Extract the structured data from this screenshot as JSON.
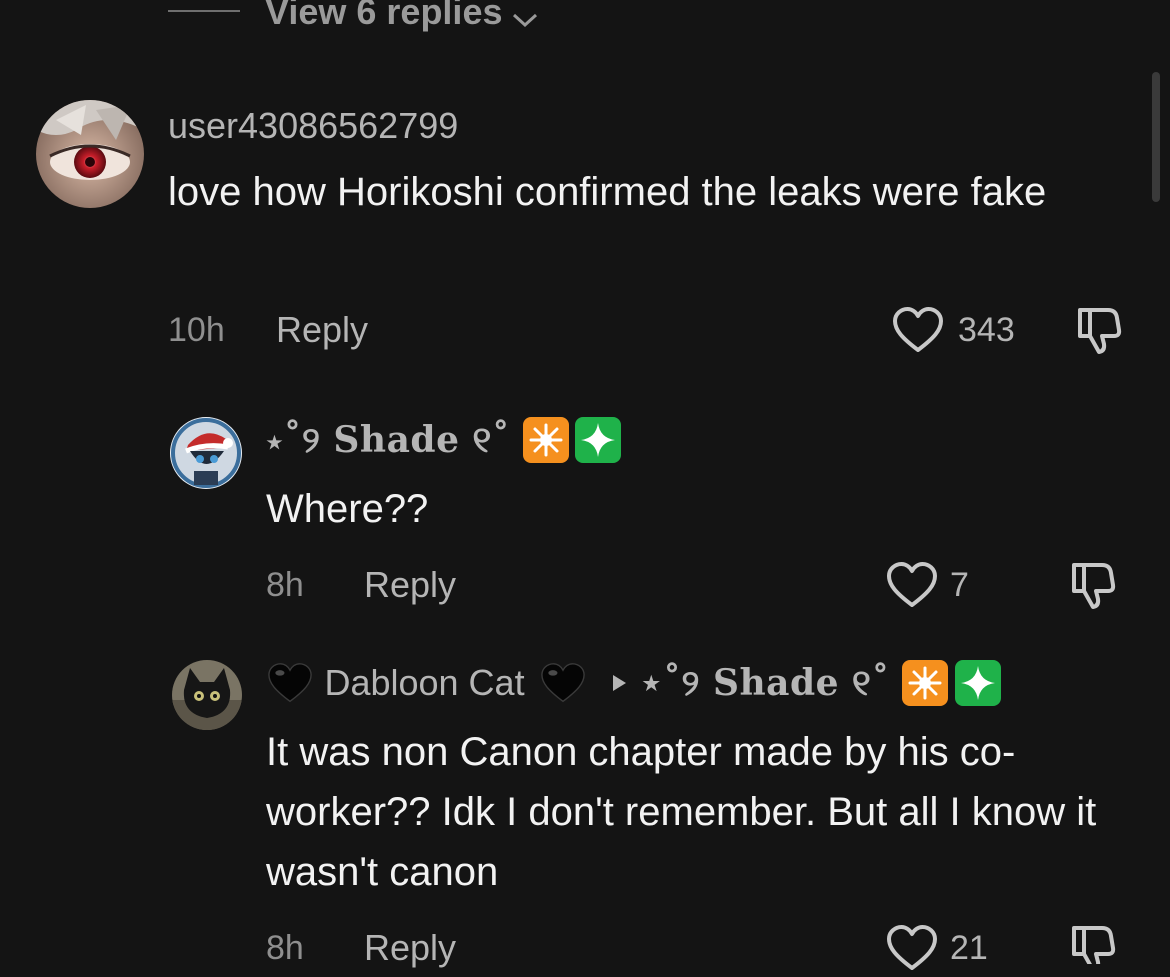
{
  "top": {
    "view_replies": "View 6 replies"
  },
  "comments": [
    {
      "username": "user43086562799",
      "text": "love how Horikoshi confirmed the leaks were fake",
      "time": "10h",
      "reply_label": "Reply",
      "likes": "343"
    },
    {
      "username": "⋆˚୨ Shade ୧˚",
      "text": "Where??",
      "time": "8h",
      "reply_label": "Reply",
      "likes": "7"
    },
    {
      "username": "Dabloon Cat",
      "reply_to": "⋆˚୨ Shade ୧˚",
      "text": "It was non Canon chapter made by his co-worker?? Idk I don't remember. But all I know it wasn't canon",
      "time": "8h",
      "reply_label": "Reply",
      "likes": "21"
    }
  ],
  "colors": {
    "background": "#141414",
    "primary_text": "#f2f2f2",
    "secondary_text": "#b5b5b5",
    "muted_text": "#8f8f8f",
    "orange_emoji": "#f5901e",
    "green_emoji": "#1fb24a"
  },
  "icons": [
    "chevron-down-icon",
    "heart-outline-icon",
    "dislike-icon",
    "black-heart-icon",
    "eight-pointed-star-icon",
    "sparkles-icon",
    "reply-to-arrow-icon"
  ]
}
